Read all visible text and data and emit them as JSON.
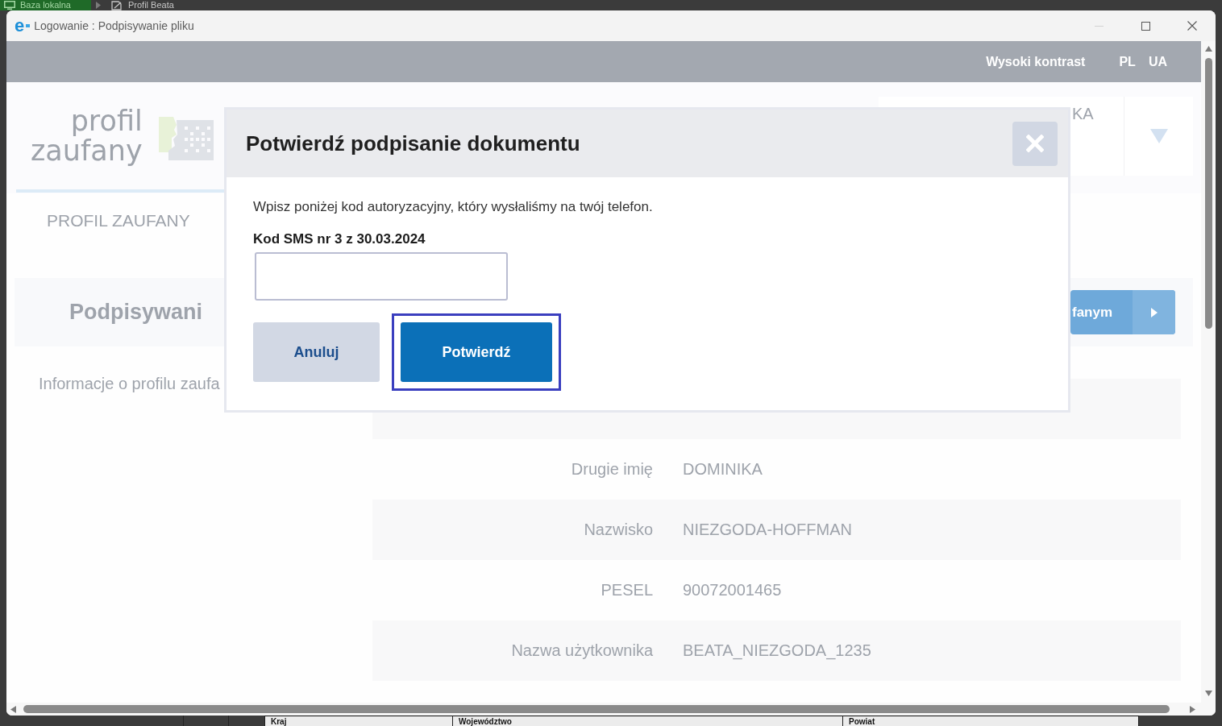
{
  "desktop": {
    "tabs": [
      {
        "label": "Baza lokalna",
        "selected": true
      },
      {
        "label": "Profil Beata",
        "selected": false
      }
    ],
    "table_columns": [
      "Kraj",
      "Województwo",
      "Powiat"
    ]
  },
  "window": {
    "app_mark": "e",
    "title": "Logowanie : Podpisywanie pliku",
    "controls": [
      {
        "kind": "minimize",
        "disabled": true
      },
      {
        "kind": "maximize",
        "disabled": false
      },
      {
        "kind": "close",
        "disabled": false
      }
    ]
  },
  "page": {
    "top_bar": {
      "contrast_link": "Wysoki kontrast",
      "languages": [
        "PL",
        "UA"
      ]
    },
    "logo": {
      "line_1": "profil",
      "line_2": "zaufany"
    },
    "user_menu": {
      "name_fragment": "KA"
    },
    "nav_label": "PROFIL ZAUFANY",
    "heading": "Podpisywani",
    "heading_button": "fanym",
    "section_title": "Informacje o profilu zaufa",
    "details": [
      {
        "label": "Drugie imię",
        "value": "DOMINIKA"
      },
      {
        "label": "Nazwisko",
        "value": "NIEZGODA-HOFFMAN"
      },
      {
        "label": "PESEL",
        "value": "90072001465"
      },
      {
        "label": "Nazwa użytkownika",
        "value": "BEATA_NIEZGODA_1235"
      }
    ]
  },
  "dialog": {
    "title": "Potwierdź podpisanie dokumentu",
    "instruction": "Wpisz poniżej kod autoryzacyjny, który wysłaliśmy na twój telefon.",
    "code_label": "Kod SMS nr 3 z 30.03.2024",
    "buttons": [
      {
        "label": "Anuluj",
        "kind": "secondary",
        "focused": false
      },
      {
        "label": "Potwierdź",
        "kind": "primary",
        "focused": true
      }
    ]
  }
}
